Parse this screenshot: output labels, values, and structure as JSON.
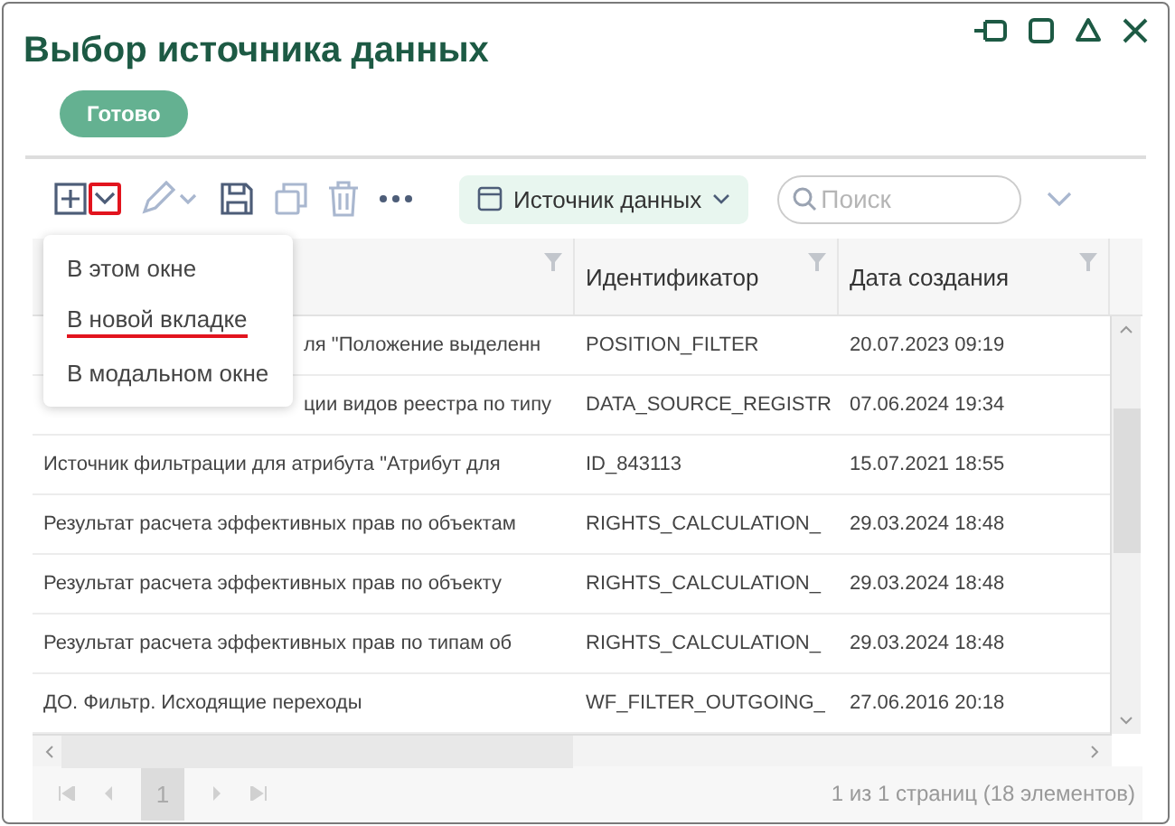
{
  "window": {
    "title": "Выбор источника данных"
  },
  "done_button": "Готово",
  "toolbar": {
    "add_menu_highlighted": true,
    "source_chip": "Источник данных",
    "search": {
      "placeholder": "Поиск"
    }
  },
  "menu": [
    {
      "label": "В этом окне",
      "highlighted": false
    },
    {
      "label": "В новой вкладке",
      "highlighted": true
    },
    {
      "label": "В модальном окне",
      "highlighted": false
    }
  ],
  "table": {
    "columns": [
      "",
      "Идентификатор",
      "Дата создания"
    ],
    "rows": [
      {
        "cells": [
          "ля \"Положение выделенн",
          "POSITION_FILTER",
          "20.07.2023 09:19"
        ],
        "partly_hidden": true
      },
      {
        "cells": [
          "ции видов реестра по типу",
          "DATA_SOURCE_REGISTR",
          "07.06.2024 19:34"
        ],
        "partly_hidden": true
      },
      {
        "cells": [
          "Источник фильтрации для атрибута \"Атрибут для",
          "ID_843113",
          "15.07.2021 18:55"
        ],
        "partly_hidden": false
      },
      {
        "cells": [
          "Результат расчета эффективных прав по объектам",
          "RIGHTS_CALCULATION_",
          "29.03.2024 18:48"
        ],
        "partly_hidden": false
      },
      {
        "cells": [
          "Результат расчета эффективных прав по объекту",
          "RIGHTS_CALCULATION_",
          "29.03.2024 18:48"
        ],
        "partly_hidden": false
      },
      {
        "cells": [
          "Результат расчета эффективных прав по типам об",
          "RIGHTS_CALCULATION_",
          "29.03.2024 18:48"
        ],
        "partly_hidden": false
      },
      {
        "cells": [
          "ДО. Фильтр. Исходящие переходы",
          "WF_FILTER_OUTGOING_",
          "27.06.2016 20:18"
        ],
        "partly_hidden": false
      }
    ]
  },
  "pager": {
    "pages": [
      {
        "label": "1",
        "selected": true
      }
    ],
    "status": "1 из 1 страниц (18 элементов)"
  }
}
